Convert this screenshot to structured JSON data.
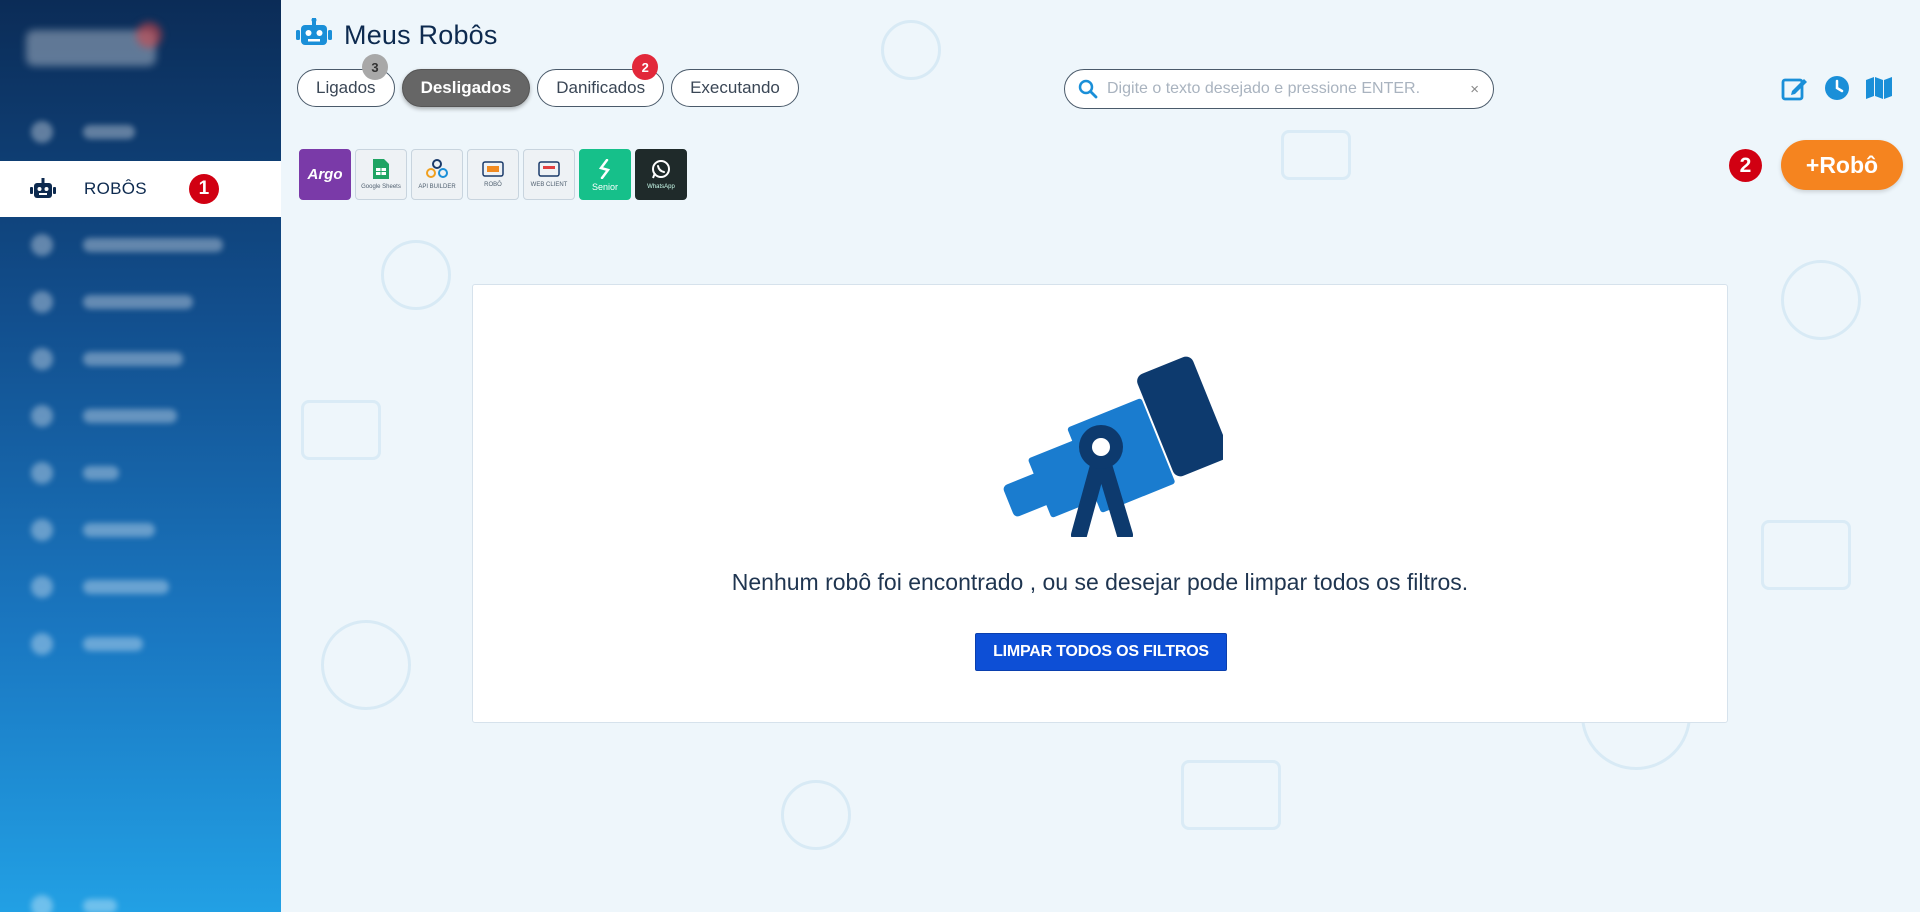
{
  "sidebar": {
    "active_item": {
      "label": "ROBÔS",
      "marker": "1"
    },
    "item_count": 11
  },
  "header": {
    "title": "Meus Robôs",
    "icon": "robot-icon"
  },
  "tabs": [
    {
      "label": "Ligados",
      "count": "3",
      "badge_color": "#a8a8a8",
      "active": false
    },
    {
      "label": "Desligados",
      "count": "",
      "active": true
    },
    {
      "label": "Danificados",
      "count": "2",
      "badge_color": "#e2283a",
      "active": false
    },
    {
      "label": "Executando",
      "count": "",
      "active": false
    }
  ],
  "search": {
    "placeholder": "Digite o texto desejado e pressione ENTER.",
    "value": "",
    "clear_label": "×"
  },
  "top_icons": [
    "edit-icon",
    "clock-icon",
    "map-icon"
  ],
  "integrations": [
    {
      "name": "argo",
      "label": "Argo"
    },
    {
      "name": "google-sheets",
      "label": "Google Sheets"
    },
    {
      "name": "api-builder",
      "label": "API BUILDER"
    },
    {
      "name": "robo",
      "label": "ROBÔ"
    },
    {
      "name": "web-client",
      "label": "WEB CLIENT"
    },
    {
      "name": "senior",
      "label": "Senior"
    },
    {
      "name": "whatsapp",
      "label": "WhatsApp"
    }
  ],
  "add_robot": {
    "label": "+Robô",
    "marker": "2"
  },
  "empty_state": {
    "message": "Nenhum robô foi encontrado , ou se desejar pode limpar todos os filtros.",
    "button_label": "LIMPAR TODOS OS FILTROS",
    "illustration": "telescope-icon"
  },
  "colors": {
    "accent_orange": "#f5841f",
    "primary_blue": "#0d4fd6",
    "sidebar_dark": "#0b2c57",
    "marker_red": "#d10012",
    "icon_blue": "#1a8fd8"
  }
}
